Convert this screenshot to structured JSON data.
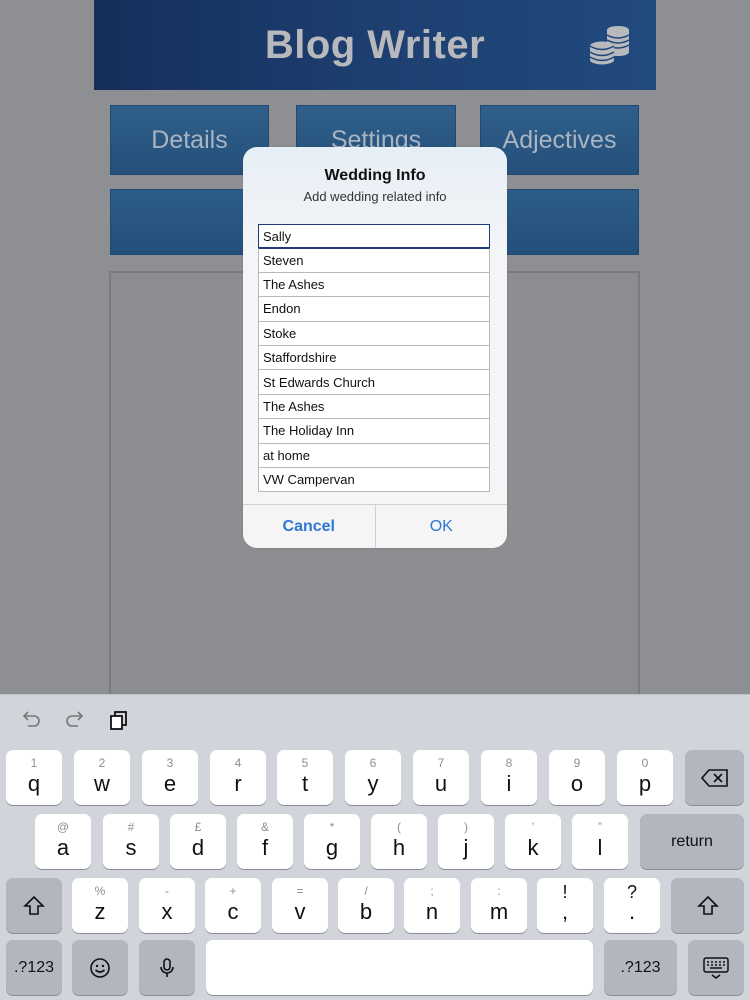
{
  "app": {
    "title": "Blog Writer",
    "nav": [
      "Details",
      "Settings",
      "Adjectives"
    ]
  },
  "dialog": {
    "title": "Wedding Info",
    "subtitle": "Add wedding related info",
    "fields": [
      "Sally",
      "Steven",
      "The Ashes",
      "Endon",
      "Stoke",
      "Staffordshire",
      "St Edwards Church",
      "The Ashes",
      "The Holiday Inn",
      "at home",
      "VW Campervan"
    ],
    "cancel_label": "Cancel",
    "ok_label": "OK"
  },
  "keyboard": {
    "row1": [
      {
        "main": "q",
        "sub": "1"
      },
      {
        "main": "w",
        "sub": "2"
      },
      {
        "main": "e",
        "sub": "3"
      },
      {
        "main": "r",
        "sub": "4"
      },
      {
        "main": "t",
        "sub": "5"
      },
      {
        "main": "y",
        "sub": "6"
      },
      {
        "main": "u",
        "sub": "7"
      },
      {
        "main": "i",
        "sub": "8"
      },
      {
        "main": "o",
        "sub": "9"
      },
      {
        "main": "p",
        "sub": "0"
      }
    ],
    "row2": [
      {
        "main": "a",
        "sub": "@"
      },
      {
        "main": "s",
        "sub": "#"
      },
      {
        "main": "d",
        "sub": "£"
      },
      {
        "main": "f",
        "sub": "&"
      },
      {
        "main": "g",
        "sub": "*"
      },
      {
        "main": "h",
        "sub": "("
      },
      {
        "main": "j",
        "sub": ")"
      },
      {
        "main": "k",
        "sub": "’"
      },
      {
        "main": "l",
        "sub": "”"
      }
    ],
    "row3": [
      {
        "main": "z",
        "sub": "%"
      },
      {
        "main": "x",
        "sub": "-"
      },
      {
        "main": "c",
        "sub": "+"
      },
      {
        "main": "v",
        "sub": "="
      },
      {
        "main": "b",
        "sub": "/"
      },
      {
        "main": "n",
        "sub": ";"
      },
      {
        "main": "m",
        "sub": ":"
      },
      {
        "main": ",",
        "sub": "!"
      },
      {
        "main": ".",
        "sub": "?"
      }
    ],
    "return_label": "return",
    "numbers_label": ".?123"
  }
}
